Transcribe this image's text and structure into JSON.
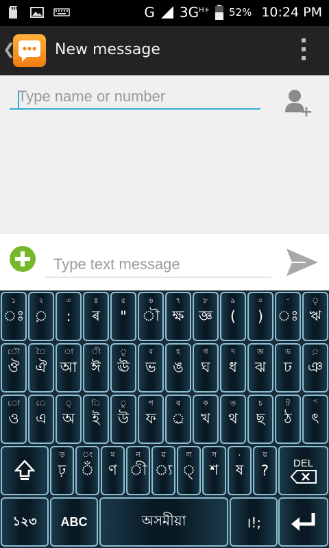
{
  "status_bar": {
    "network": "G",
    "network_3g": "3G",
    "network_hplus": "H+",
    "battery_percent": "52%",
    "time": "10:24 PM",
    "icons": [
      "sd-card-icon",
      "image-icon",
      "keyboard-icon",
      "signal-icon",
      "battery-icon"
    ]
  },
  "action_bar": {
    "title": "New message",
    "back_icon": "chevron-left-icon",
    "app_icon": "messaging-app-icon",
    "menu_icon": "overflow-menu-icon"
  },
  "recipient": {
    "placeholder": "Type name or number",
    "add_contact_icon": "add-contact-icon"
  },
  "composer": {
    "placeholder": "Type text message",
    "attach_icon": "add-attachment-icon",
    "send_icon": "send-icon"
  },
  "keyboard": {
    "row1": [
      {
        "main": "ঃ",
        "hint": "১"
      },
      {
        "main": "়",
        "hint": "২"
      },
      {
        "main": ":",
        "hint": "৩"
      },
      {
        "main": "ৰ",
        "hint": "৪"
      },
      {
        "main": "\"",
        "hint": "৫"
      },
      {
        "main": "ৗ",
        "hint": "৬"
      },
      {
        "main": "ক্ষ",
        "hint": "৭"
      },
      {
        "main": "জ্ঞ",
        "hint": "৮"
      },
      {
        "main": "(",
        "hint": "৯"
      },
      {
        "main": ")",
        "hint": "০"
      },
      {
        "main": "ঃ",
        "hint": "-"
      },
      {
        "main": "ঋ",
        "hint": "ৃ"
      }
    ],
    "row2": [
      {
        "main": "ঔ",
        "hint": "ৌ"
      },
      {
        "main": "ঐ",
        "hint": "ৈ"
      },
      {
        "main": "আ",
        "hint": "া"
      },
      {
        "main": "ঈ",
        "hint": "ী"
      },
      {
        "main": "ঊ",
        "hint": "ূ"
      },
      {
        "main": "ভ",
        "hint": "ব"
      },
      {
        "main": "ঙ",
        "hint": "হ"
      },
      {
        "main": "ঘ",
        "hint": "গ"
      },
      {
        "main": "ধ",
        "hint": "দ"
      },
      {
        "main": "ঝ",
        "hint": "জ"
      },
      {
        "main": "ঢ",
        "hint": "ড"
      },
      {
        "main": "ঞ",
        "hint": "়"
      }
    ],
    "row3": [
      {
        "main": "ও",
        "hint": "ো"
      },
      {
        "main": "এ",
        "hint": "ে"
      },
      {
        "main": "অ",
        "hint": "্"
      },
      {
        "main": "ই",
        "hint": "ি"
      },
      {
        "main": "উ",
        "hint": "ু"
      },
      {
        "main": "ফ",
        "hint": "প"
      },
      {
        "main": "্ৰ",
        "hint": "ৰ"
      },
      {
        "main": "খ",
        "hint": "ক"
      },
      {
        "main": "থ",
        "hint": "ত"
      },
      {
        "main": "ছ",
        "hint": "চ"
      },
      {
        "main": "ঠ",
        "hint": "ট"
      },
      {
        "main": "ৎ",
        "hint": "ৼ"
      }
    ],
    "row4": [
      {
        "main": "ঢ়",
        "hint": "ড়"
      },
      {
        "main": "ঁ",
        "hint": "ং"
      },
      {
        "main": "ণ",
        "hint": "ম"
      },
      {
        "main": "ী",
        "hint": "ন"
      },
      {
        "main": "্য",
        "hint": "ৱ"
      },
      {
        "main": "্",
        "hint": "ল"
      },
      {
        "main": "শ",
        "hint": "স"
      },
      {
        "main": "ষ",
        "hint": ","
      },
      {
        "main": "?",
        "hint": "য়"
      }
    ],
    "del_label": "DEL",
    "numbers_label": "১২৩",
    "abc_label": "ABC",
    "space_label": "অসমীয়া",
    "punct_label": "।!;",
    "shift_icon": "shift-icon",
    "delete_icon": "backspace-icon",
    "enter_icon": "enter-icon"
  }
}
